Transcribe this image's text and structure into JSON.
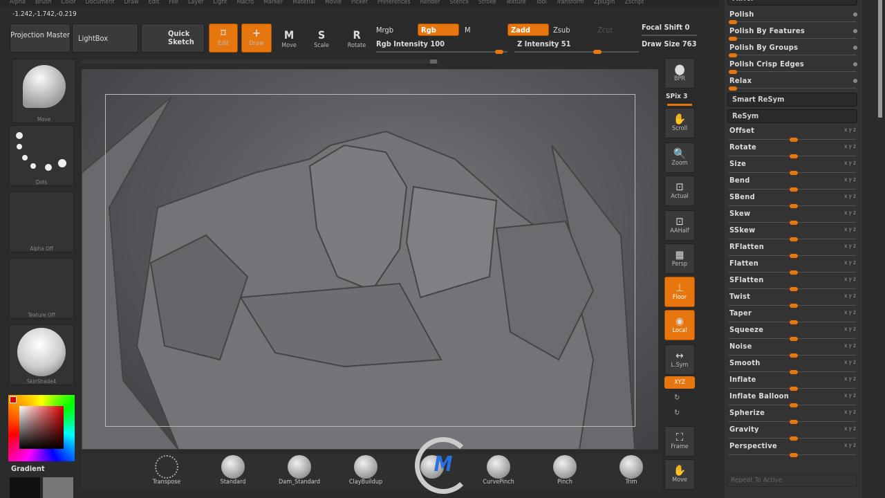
{
  "menu": [
    "Alpha",
    "Brush",
    "Color",
    "Document",
    "Draw",
    "Edit",
    "File",
    "Layer",
    "Light",
    "Macro",
    "Marker",
    "Material",
    "Movie",
    "Picker",
    "Preferences",
    "Render",
    "Stencil",
    "Stroke",
    "Texture",
    "Tool",
    "Transform",
    "Zplugin",
    "Zscript"
  ],
  "coords": "-1.242,-1.742,-0.219",
  "toolbar": {
    "projection_master": "Projection Master",
    "lightbox": "LightBox",
    "quick_sketch": "Quick Sketch",
    "edit": "Edit",
    "draw": "Draw",
    "move": "Move",
    "scale": "Scale",
    "rotate": "Rotate",
    "mrgb": "Mrgb",
    "rgb": "Rgb",
    "m": "M",
    "zadd": "Zadd",
    "zsub": "Zsub",
    "zcut": "Zcut",
    "rgb_intensity": "Rgb Intensity 100",
    "z_intensity": "Z Intensity 51",
    "focal_shift": "Focal Shift 0",
    "draw_size": "Draw Size 763",
    "rgb_intensity_value": 100,
    "z_intensity_value": 51
  },
  "left": {
    "brush": "Move",
    "stroke": "Dots",
    "alpha": "Alpha Off",
    "texture": "Texture Off",
    "material": "SkinShade4",
    "gradient": "Gradient"
  },
  "shelf": {
    "bpr": "BPR",
    "spix": "SPix 3",
    "scroll": "Scroll",
    "zoom": "Zoom",
    "actual": "Actual",
    "aahalf": "AAHalf",
    "persp": "Persp",
    "floor": "Floor",
    "local": "Local",
    "lsym": "L.Sym",
    "xyz": "XYZ",
    "frame": "Frame",
    "move": "Move"
  },
  "brushes": [
    "Transpose",
    "Standard",
    "Dam_Standard",
    "ClayBuildup",
    "",
    "CurvePinch",
    "Pinch",
    "Trim"
  ],
  "panel": {
    "header": "Mirror",
    "polish": [
      "Polish",
      "Polish By Features",
      "Polish By Groups",
      "Polish Crisp Edges",
      "Relax"
    ],
    "smart_resym": "Smart ReSym",
    "resym": "ReSym",
    "deform": [
      "Offset",
      "Rotate",
      "Size",
      "Bend",
      "SBend",
      "Skew",
      "SSkew",
      "RFlatten",
      "Flatten",
      "SFlatten",
      "Twist",
      "Taper",
      "Squeeze",
      "Noise",
      "Smooth",
      "Inflate",
      "Inflate Balloon",
      "Spherize",
      "Gravity",
      "Perspective"
    ],
    "axis": "x y z",
    "repeat": "Repeat To Active"
  },
  "colors": {
    "accent": "#e8760f",
    "panel": "#333333",
    "bg": "#2b2b2b"
  }
}
